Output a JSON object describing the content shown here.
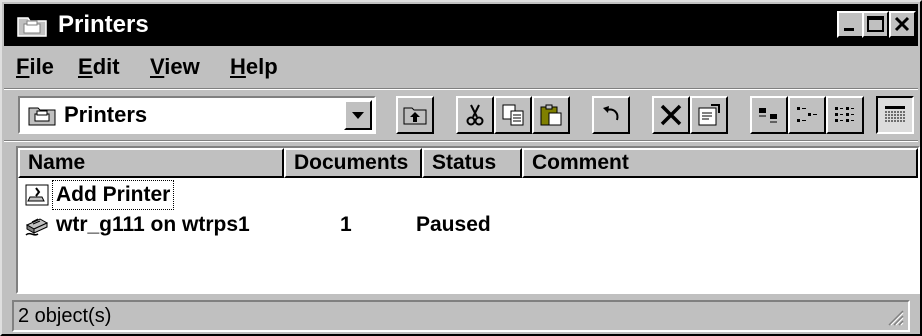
{
  "window": {
    "title": "Printers",
    "icon": "printers-folder-icon",
    "controls": [
      "minimize",
      "maximize",
      "close"
    ]
  },
  "menubar": {
    "items": [
      {
        "accel": "F",
        "rest": "ile"
      },
      {
        "accel": "E",
        "rest": "dit"
      },
      {
        "accel": "V",
        "rest": "iew"
      },
      {
        "accel": "H",
        "rest": "elp"
      }
    ]
  },
  "toolbar": {
    "combo": {
      "value": "Printers",
      "icon": "printers-folder-icon"
    },
    "buttons": [
      "up-one-level-icon",
      "cut-icon",
      "copy-icon",
      "paste-icon",
      "undo-icon",
      "delete-icon",
      "properties-icon",
      "large-icons-icon",
      "small-icons-icon",
      "list-icon",
      "details-icon"
    ],
    "pressed": "details-icon"
  },
  "list": {
    "columns": [
      "Name",
      "Documents",
      "Status",
      "Comment"
    ],
    "rows": [
      {
        "name": "Add Printer",
        "documents": "",
        "status": "",
        "comment": "",
        "icon": "add-printer-icon"
      },
      {
        "name": "wtr_g111 on wtrps1",
        "documents": "1",
        "status": "Paused",
        "comment": "",
        "icon": "network-printer-icon"
      }
    ]
  },
  "statusbar": {
    "text": "2 object(s)"
  }
}
